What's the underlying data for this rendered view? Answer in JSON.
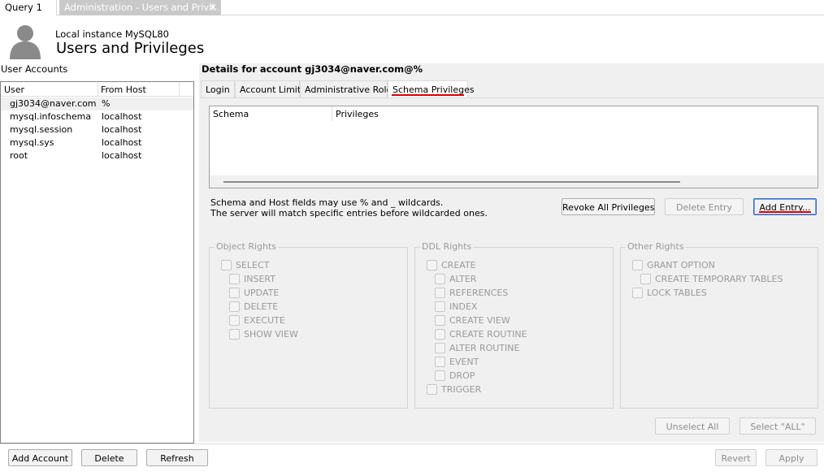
{
  "tabs": [
    {
      "label": "Query 1"
    },
    {
      "label": "Administration - Users and Privil..."
    }
  ],
  "header": {
    "subtitle": "Local instance MySQL80",
    "title": "Users and Privileges"
  },
  "user_accounts": {
    "label": "User Accounts",
    "columns": [
      "User",
      "From Host"
    ],
    "rows": [
      {
        "user": "gj3034@naver.com",
        "host": "%"
      },
      {
        "user": "mysql.infoschema",
        "host": "localhost"
      },
      {
        "user": "mysql.session",
        "host": "localhost"
      },
      {
        "user": "mysql.sys",
        "host": "localhost"
      },
      {
        "user": "root",
        "host": "localhost"
      }
    ]
  },
  "details": {
    "title": "Details for account gj3034@naver.com@%",
    "tabs": [
      "Login",
      "Account Limits",
      "Administrative Roles",
      "Schema Privileges"
    ],
    "schema_table": {
      "columns": [
        "Schema",
        "Privileges"
      ]
    },
    "hint_line1": "Schema and Host fields may use % and _ wildcards.",
    "hint_line2": "The server will match specific entries before wildcarded ones.",
    "buttons": {
      "revoke_all": "Revoke All Privileges",
      "delete_entry": "Delete Entry",
      "add_entry": "Add Entry..."
    },
    "groups": {
      "object_rights": {
        "title": "Object Rights",
        "items": [
          "SELECT",
          "INSERT",
          "UPDATE",
          "DELETE",
          "EXECUTE",
          "SHOW VIEW"
        ]
      },
      "ddl_rights": {
        "title": "DDL Rights",
        "items": [
          "CREATE",
          "ALTER",
          "REFERENCES",
          "INDEX",
          "CREATE VIEW",
          "CREATE ROUTINE",
          "ALTER ROUTINE",
          "EVENT",
          "DROP",
          "TRIGGER"
        ]
      },
      "other_rights": {
        "title": "Other Rights",
        "items": [
          "GRANT OPTION",
          "CREATE TEMPORARY TABLES",
          "LOCK TABLES"
        ]
      }
    },
    "unselect_all": "Unselect All",
    "select_all": "Select \"ALL\""
  },
  "footer": {
    "add_account": "Add Account",
    "delete": "Delete",
    "refresh": "Refresh",
    "revert": "Revert",
    "apply": "Apply"
  }
}
